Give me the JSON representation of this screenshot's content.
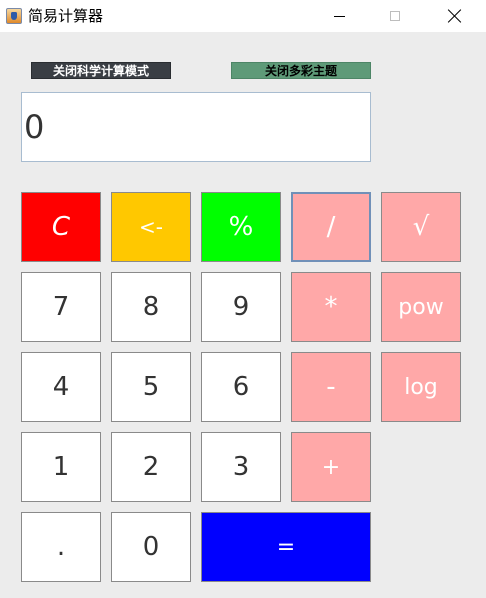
{
  "window": {
    "title": "简易计算器"
  },
  "toggles": {
    "scientific": "关闭科学计算模式",
    "theme": "关闭多彩主题"
  },
  "display": {
    "value": "0"
  },
  "keys": {
    "clear": "C",
    "backspace": "<-",
    "percent": "%",
    "divide": "/",
    "sqrt": "√",
    "seven": "7",
    "eight": "8",
    "nine": "9",
    "multiply": "*",
    "pow": "pow",
    "four": "4",
    "five": "5",
    "six": "6",
    "subtract": "-",
    "log": "log",
    "one": "1",
    "two": "2",
    "three": "3",
    "add": "+",
    "dot": ".",
    "zero": "0",
    "equals": "="
  },
  "colors": {
    "clear": "#ff0000",
    "backspace": "#ffc800",
    "percent": "#00ff00",
    "operator": "#ffa8a8",
    "equals": "#0000ff",
    "scientific_toggle": "#3a3e44",
    "theme_toggle": "#5e9a78"
  },
  "icons": [
    "app-icon",
    "minimize-icon",
    "maximize-icon",
    "close-icon"
  ]
}
